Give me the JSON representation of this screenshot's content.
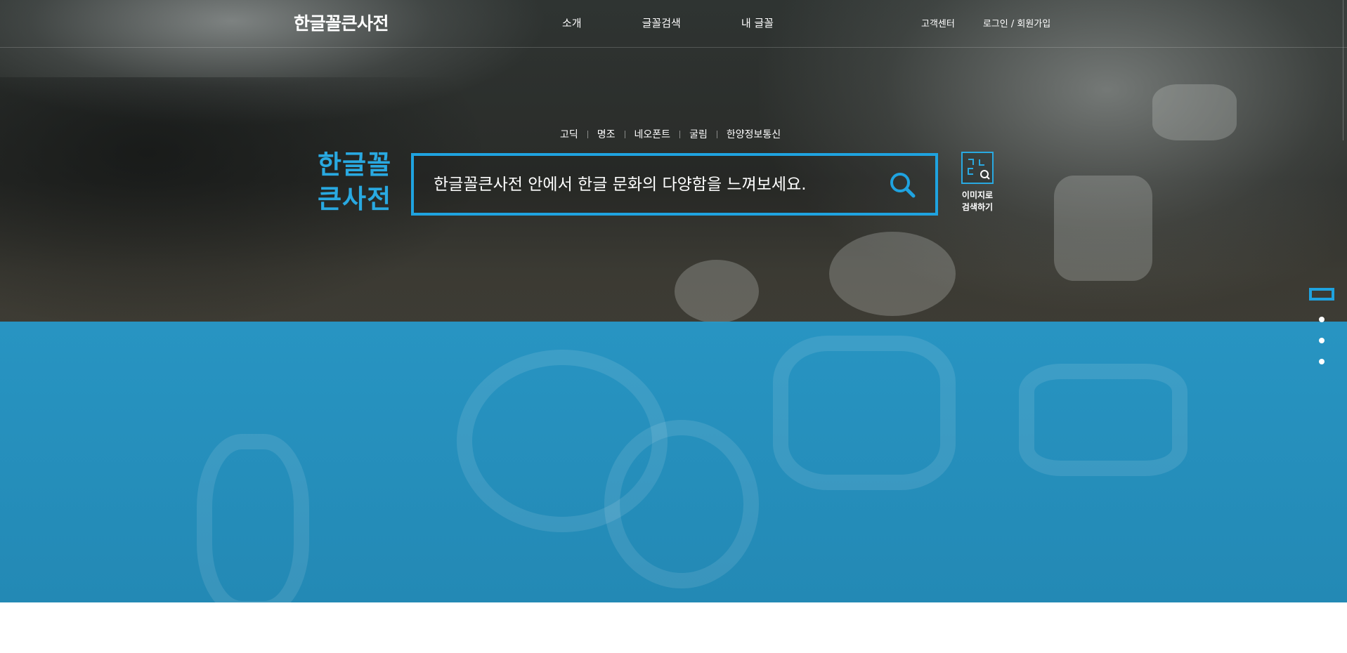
{
  "header": {
    "logo": "한글꼴큰사전",
    "nav": [
      "소개",
      "글꼴검색",
      "내 글꼴"
    ],
    "util": {
      "support": "고객센터",
      "login": "로그인 / 회원가입"
    }
  },
  "categories": [
    "고딕",
    "명조",
    "네오폰트",
    "굴림",
    "한양정보통신"
  ],
  "brand": {
    "line1": "한글꼴",
    "line2": "큰사전"
  },
  "search": {
    "placeholder": "한글꼴큰사전 안에서 한글 문화의 다양함을 느껴보세요.",
    "icon": "search-icon"
  },
  "image_search": {
    "label": "이미지로\n검색하기",
    "icon": "image-search-icon"
  },
  "pager": {
    "total": 4,
    "active_index": 0
  },
  "colors": {
    "accent": "#1fa3e0",
    "band": "#269bcd"
  }
}
